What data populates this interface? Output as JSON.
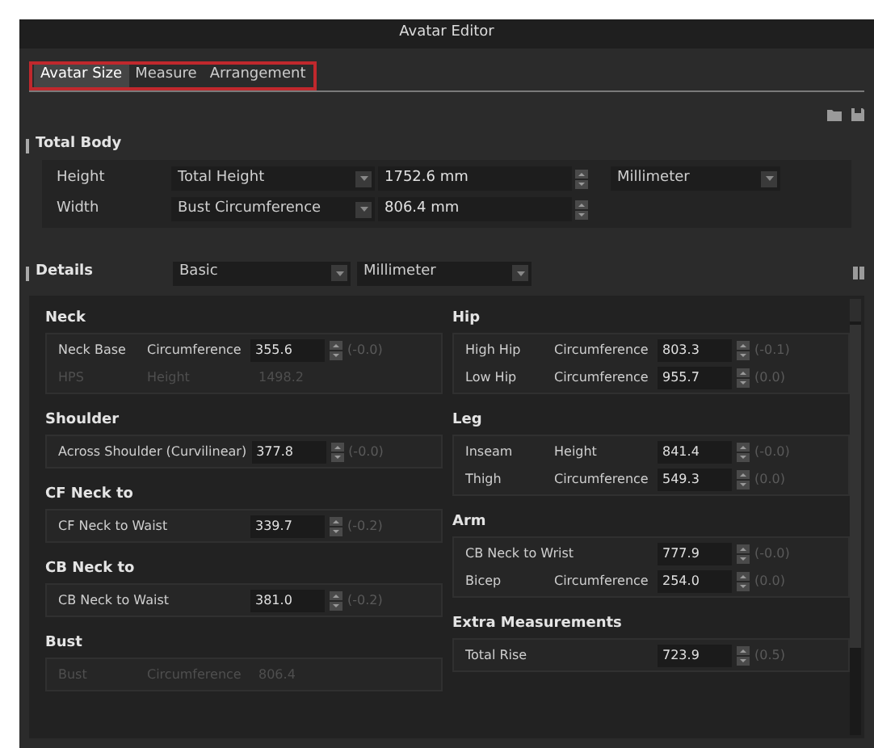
{
  "window": {
    "title": "Avatar Editor"
  },
  "tabs": [
    {
      "label": "Avatar Size",
      "selected": true
    },
    {
      "label": "Measure",
      "selected": false
    },
    {
      "label": "Arrangement",
      "selected": false
    }
  ],
  "total_body": {
    "title": "Total Body",
    "rows": [
      {
        "label": "Height",
        "measure": "Total Height",
        "value": "1752.6 mm",
        "unit": "Millimeter"
      },
      {
        "label": "Width",
        "measure": "Bust Circumference",
        "value": "806.4 mm"
      }
    ]
  },
  "details": {
    "title": "Details",
    "preset": "Basic",
    "unit": "Millimeter",
    "columns": [
      [
        {
          "title": "Neck",
          "rows": [
            {
              "label": "Neck Base",
              "param": "Circumference",
              "value": "355.6",
              "delta": "(-0.0)",
              "disabled": false
            },
            {
              "label": "HPS",
              "param": "Height",
              "value": "1498.2",
              "disabled": true
            }
          ]
        },
        {
          "title": "Shoulder",
          "rows": [
            {
              "label": "Across Shoulder (Curvilinear)",
              "value": "377.8",
              "delta": "(-0.0)",
              "disabled": false
            }
          ]
        },
        {
          "title": "CF Neck to",
          "rows": [
            {
              "label": "CF Neck to Waist",
              "value": "339.7",
              "delta": "(-0.2)",
              "disabled": false
            }
          ]
        },
        {
          "title": "CB Neck to",
          "rows": [
            {
              "label": "CB Neck to Waist",
              "value": "381.0",
              "delta": "(-0.2)",
              "disabled": false
            }
          ]
        },
        {
          "title": "Bust",
          "rows": [
            {
              "label": "Bust",
              "param": "Circumference",
              "value": "806.4",
              "disabled": true
            }
          ]
        }
      ],
      [
        {
          "title": "Hip",
          "rows": [
            {
              "label": "High Hip",
              "param": "Circumference",
              "value": "803.3",
              "delta": "(-0.1)",
              "disabled": false
            },
            {
              "label": "Low Hip",
              "param": "Circumference",
              "value": "955.7",
              "delta": "(0.0)",
              "disabled": false
            }
          ]
        },
        {
          "title": "Leg",
          "rows": [
            {
              "label": "Inseam",
              "param": "Height",
              "value": "841.4",
              "delta": "(-0.0)",
              "disabled": false
            },
            {
              "label": "Thigh",
              "param": "Circumference",
              "value": "549.3",
              "delta": "(0.0)",
              "disabled": false
            }
          ]
        },
        {
          "title": "Arm",
          "rows": [
            {
              "label": "CB Neck to Wrist",
              "value": "777.9",
              "delta": "(-0.0)",
              "disabled": false
            },
            {
              "label": "Bicep",
              "param": "Circumference",
              "value": "254.0",
              "delta": "(0.0)",
              "disabled": false
            }
          ]
        },
        {
          "title": "Extra Measurements",
          "rows": [
            {
              "label": "Total Rise",
              "value": "723.9",
              "delta": "(0.5)",
              "disabled": false
            }
          ]
        }
      ]
    ]
  }
}
